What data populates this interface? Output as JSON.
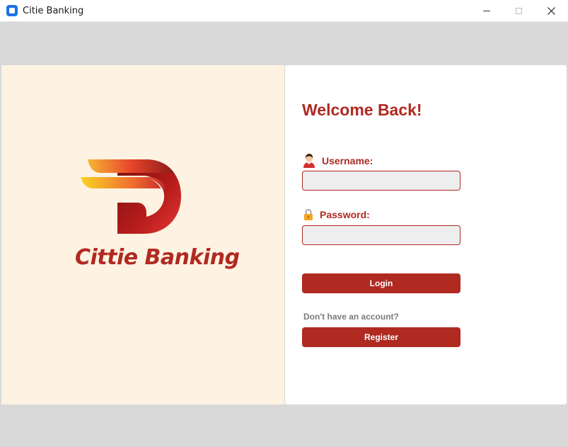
{
  "window": {
    "title": "Citie Banking",
    "app_icon": "app-icon",
    "controls": [
      "minimize-icon",
      "maximize-icon",
      "close-icon"
    ]
  },
  "branding": {
    "logo": "citie-banking-logo",
    "name": "Cittie Banking"
  },
  "login": {
    "heading": "Welcome Back!",
    "username_label": "Username:",
    "username_icon": "user-icon",
    "username_value": "",
    "password_label": "Password:",
    "password_icon": "lock-icon",
    "password_value": "",
    "login_button": "Login",
    "no_account_text": "Don't have an account?",
    "register_button": "Register"
  },
  "colors": {
    "accent": "#b02a22",
    "left_panel_bg": "#fef3e2",
    "field_bg": "#eeeeee",
    "window_bg": "#d9d9d9"
  }
}
